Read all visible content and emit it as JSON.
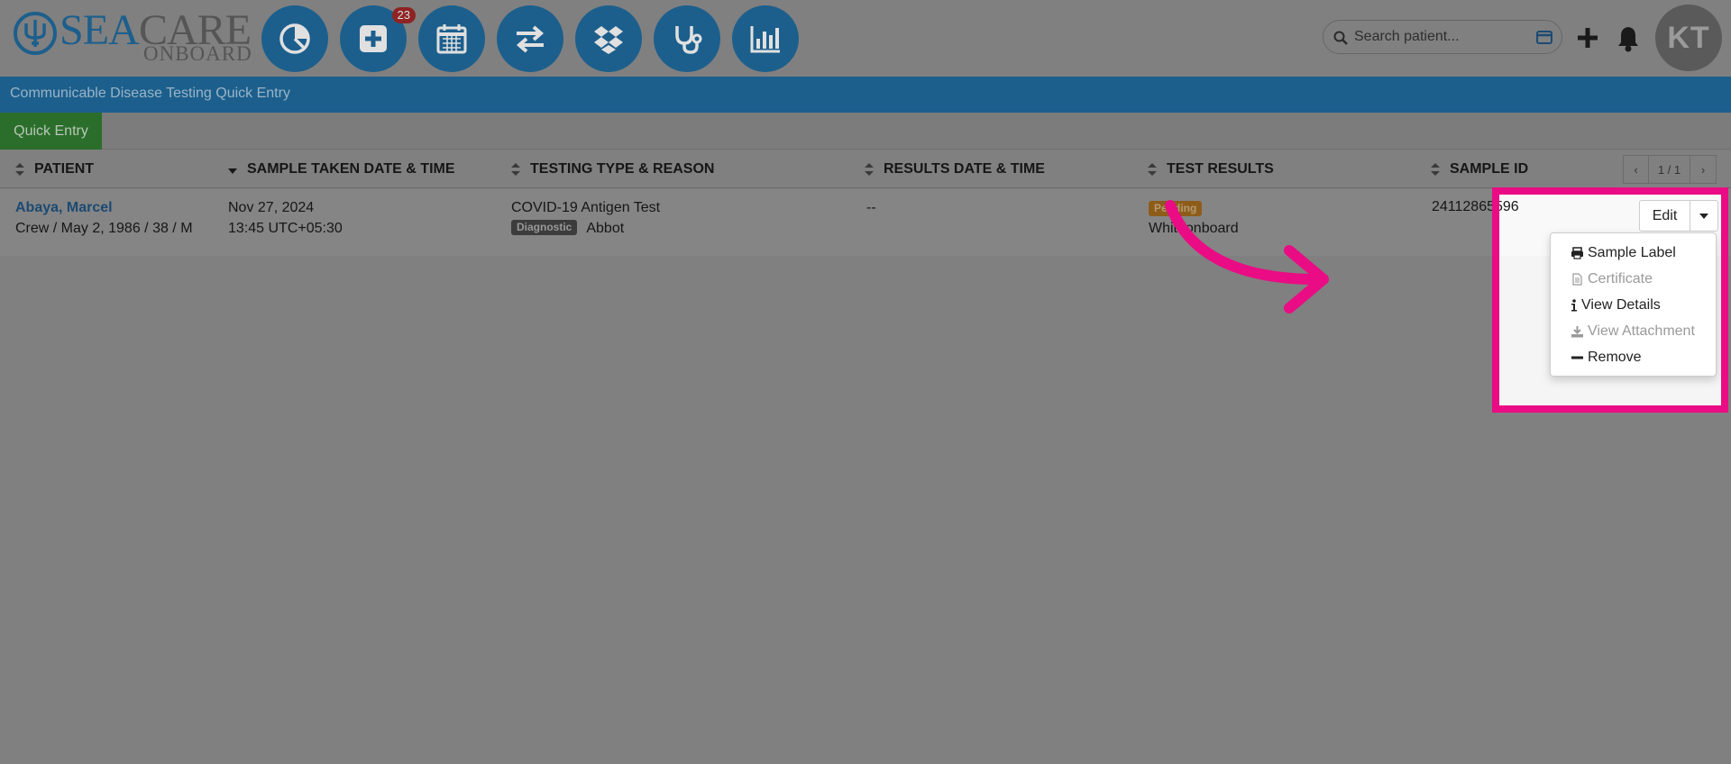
{
  "brand": {
    "word1": "SEA",
    "word2": "CARE",
    "word3": "ONBOARD"
  },
  "nav": {
    "items": [
      {
        "name": "dashboard",
        "icon": "pie-chart-icon"
      },
      {
        "name": "medical",
        "icon": "plus-square-icon",
        "badge": "23"
      },
      {
        "name": "calendar",
        "icon": "calendar-icon"
      },
      {
        "name": "transfer",
        "icon": "exchange-icon"
      },
      {
        "name": "inventory",
        "icon": "dropbox-icon"
      },
      {
        "name": "consult",
        "icon": "stethoscope-icon"
      },
      {
        "name": "reports",
        "icon": "bar-chart-icon"
      }
    ]
  },
  "search": {
    "placeholder": "Search patient..."
  },
  "user": {
    "initials": "KT"
  },
  "page": {
    "title": "Communicable Disease Testing Quick Entry",
    "quick_entry_label": "Quick Entry"
  },
  "table": {
    "columns": [
      "PATIENT",
      "SAMPLE TAKEN DATE & TIME",
      "TESTING TYPE & REASON",
      "RESULTS DATE & TIME",
      "TEST RESULTS",
      "SAMPLE ID"
    ],
    "pager": {
      "prev": "‹",
      "label": "1 / 1",
      "next": "›"
    },
    "rows": [
      {
        "patient_name": "Abaya, Marcel",
        "patient_info": "Crew / May 2, 1986 / 38 / M",
        "sample_date": "Nov 27, 2024",
        "sample_time": "13:45 UTC+05:30",
        "test_type": "COVID-19 Antigen Test",
        "reason_tag": "Diagnostic",
        "manufacturer": "Abbot",
        "results_datetime": "--",
        "result_status": "Pending",
        "result_location": "Whiteonboard",
        "sample_id": "24112865596"
      }
    ]
  },
  "actions": {
    "edit_label": "Edit",
    "menu": [
      {
        "label": "Sample Label",
        "icon": "print-icon",
        "enabled": true
      },
      {
        "label": "Certificate",
        "icon": "file-icon",
        "enabled": false
      },
      {
        "label": "View Details",
        "icon": "info-icon",
        "enabled": true
      },
      {
        "label": "View Attachment",
        "icon": "download-icon",
        "enabled": false
      },
      {
        "label": "Remove",
        "icon": "minus-icon",
        "enabled": true
      }
    ]
  },
  "colors": {
    "brand_blue": "#1c5f8d",
    "highlight": "#ea0c84",
    "overlay": "#808080"
  }
}
